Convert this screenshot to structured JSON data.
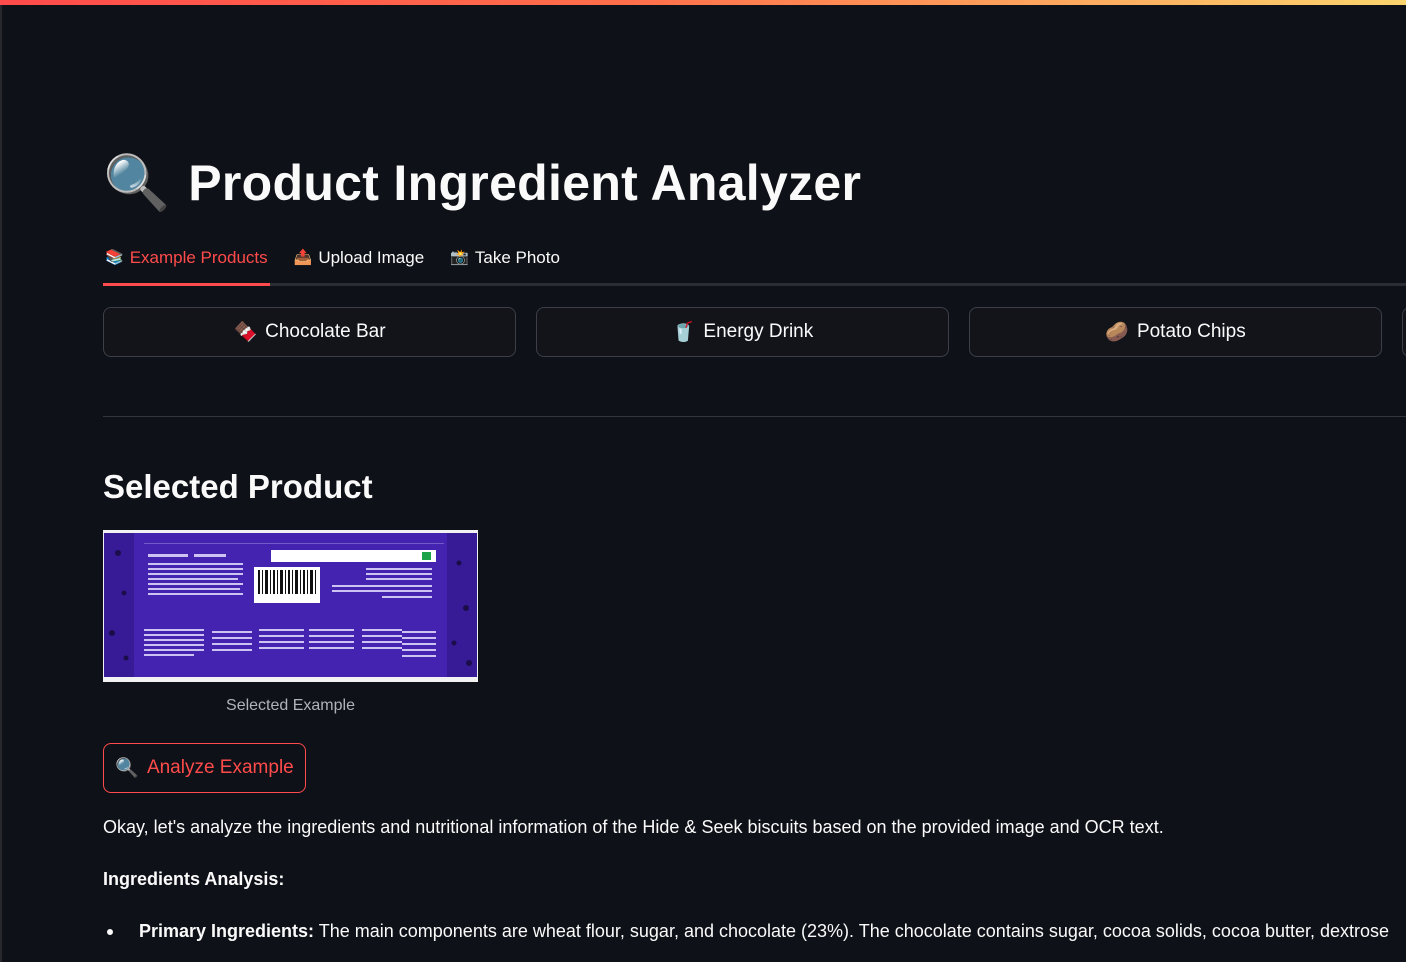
{
  "app": {
    "title_icon": "magnifier-icon",
    "title": "Product Ingredient Analyzer",
    "accent_color": "#ff4b4b",
    "background_color": "#0e1117"
  },
  "tabs": [
    {
      "icon": "📚",
      "label": "Example Products",
      "active": true
    },
    {
      "icon": "📤",
      "label": "Upload Image",
      "active": false
    },
    {
      "icon": "📸",
      "label": "Take Photo",
      "active": false
    }
  ],
  "examples": [
    {
      "icon": "🍫",
      "label": "Chocolate Bar"
    },
    {
      "icon": "🥤",
      "label": "Energy Drink"
    },
    {
      "icon": "🥔",
      "label": "Potato Chips"
    }
  ],
  "selected": {
    "heading": "Selected Product",
    "caption": "Selected Example"
  },
  "analyze_button": {
    "icon": "🔍",
    "label": "Analyze Example"
  },
  "result": {
    "intro": "Okay, let's analyze the ingredients and nutritional information of the Hide & Seek biscuits based on the provided image and OCR text.",
    "subheading": "Ingredients Analysis:",
    "bullets": [
      {
        "label": "Primary Ingredients:",
        "text": " The main components are wheat flour, sugar, and chocolate (23%). The chocolate contains sugar, cocoa solids, cocoa butter, dextrose"
      }
    ]
  }
}
